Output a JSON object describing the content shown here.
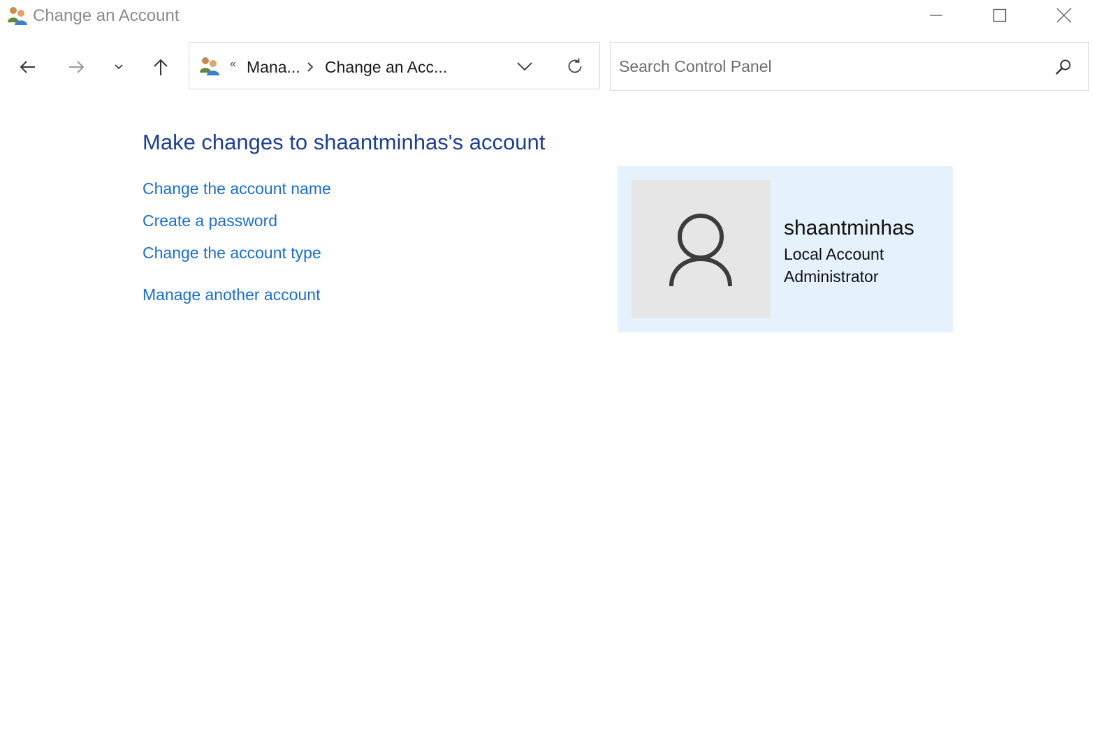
{
  "window": {
    "title": "Change an Account",
    "icon": "user-accounts-icon",
    "controls": {
      "minimize_icon": "minimize-icon",
      "maximize_icon": "maximize-icon",
      "close_icon": "close-icon"
    }
  },
  "navigation": {
    "back_icon": "arrow-left-icon",
    "forward_icon": "arrow-right-icon",
    "recent_icon": "chevron-down-icon",
    "up_icon": "arrow-up-icon"
  },
  "address_bar": {
    "overflow": "«",
    "breadcrumbs": [
      {
        "label": "Mana..."
      },
      {
        "label": "Change an Acc..."
      }
    ],
    "separator_icon": "chevron-right-icon",
    "dropdown_icon": "chevron-down-icon",
    "refresh_icon": "refresh-icon"
  },
  "search": {
    "placeholder": "Search Control Panel",
    "value": "",
    "icon": "search-icon"
  },
  "main": {
    "heading": "Make changes to shaantminhas's account",
    "links": [
      {
        "label": "Change the account name"
      },
      {
        "label": "Create a password"
      },
      {
        "label": "Change the account type"
      },
      {
        "label": "Manage another account"
      }
    ]
  },
  "account": {
    "name": "shaantminhas",
    "type": "Local Account",
    "role": "Administrator",
    "avatar_icon": "user-avatar-icon"
  },
  "colors": {
    "heading": "#1e3f8f",
    "link": "#1a6fc9",
    "card_background": "#e5f1fb",
    "avatar_background": "#e6e6e6"
  }
}
